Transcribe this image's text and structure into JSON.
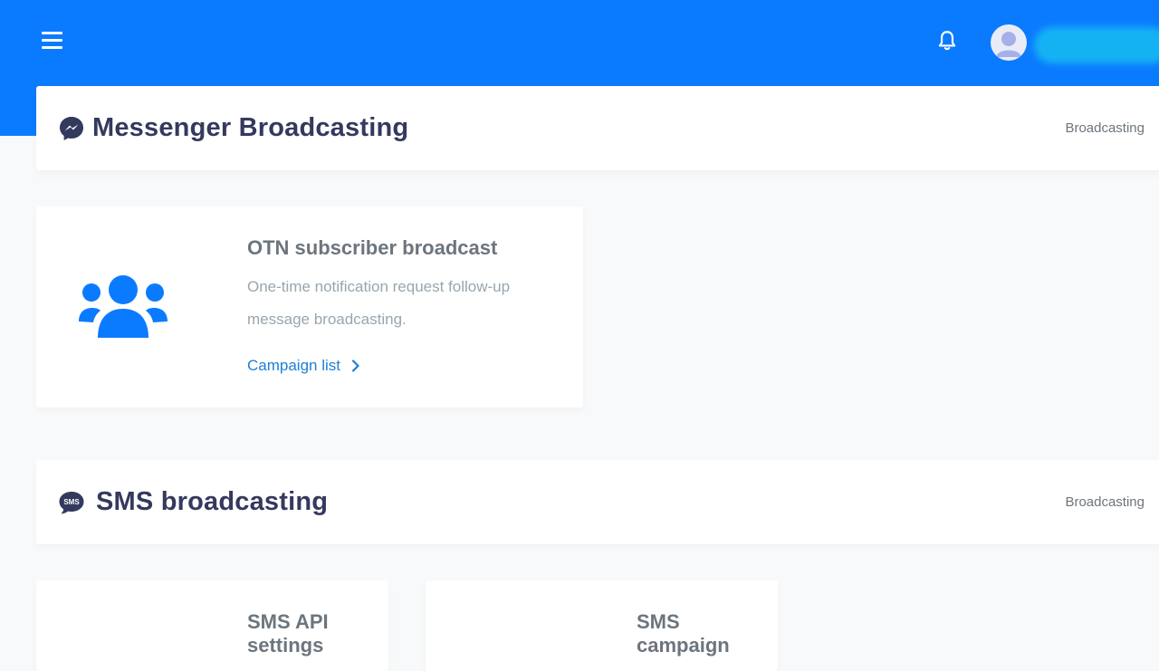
{
  "header": {
    "menu_icon": "hamburger-icon",
    "notification_icon": "bell-icon",
    "avatar_icon": "user-avatar"
  },
  "sections": [
    {
      "title": "Messenger Broadcasting",
      "icon": "messenger-icon",
      "breadcrumb": "Broadcasting",
      "cards": [
        {
          "title": "OTN subscriber broadcast",
          "description_line1": "One-time notification request follow-up",
          "description_line2": "message broadcasting.",
          "link": "Campaign list",
          "icon": "users-group-icon"
        }
      ]
    },
    {
      "title": "SMS broadcasting",
      "icon": "sms-icon",
      "icon_text": "SMS",
      "breadcrumb": "Broadcasting",
      "cards": [
        {
          "title_line1": "SMS API",
          "title_line2": "settings"
        },
        {
          "title_line1": "SMS",
          "title_line2": "campaign"
        }
      ]
    }
  ],
  "colors": {
    "accent": "#0a7bff",
    "link": "#1e7fd6",
    "heading": "#34395e",
    "muted": "#98a6ad"
  }
}
